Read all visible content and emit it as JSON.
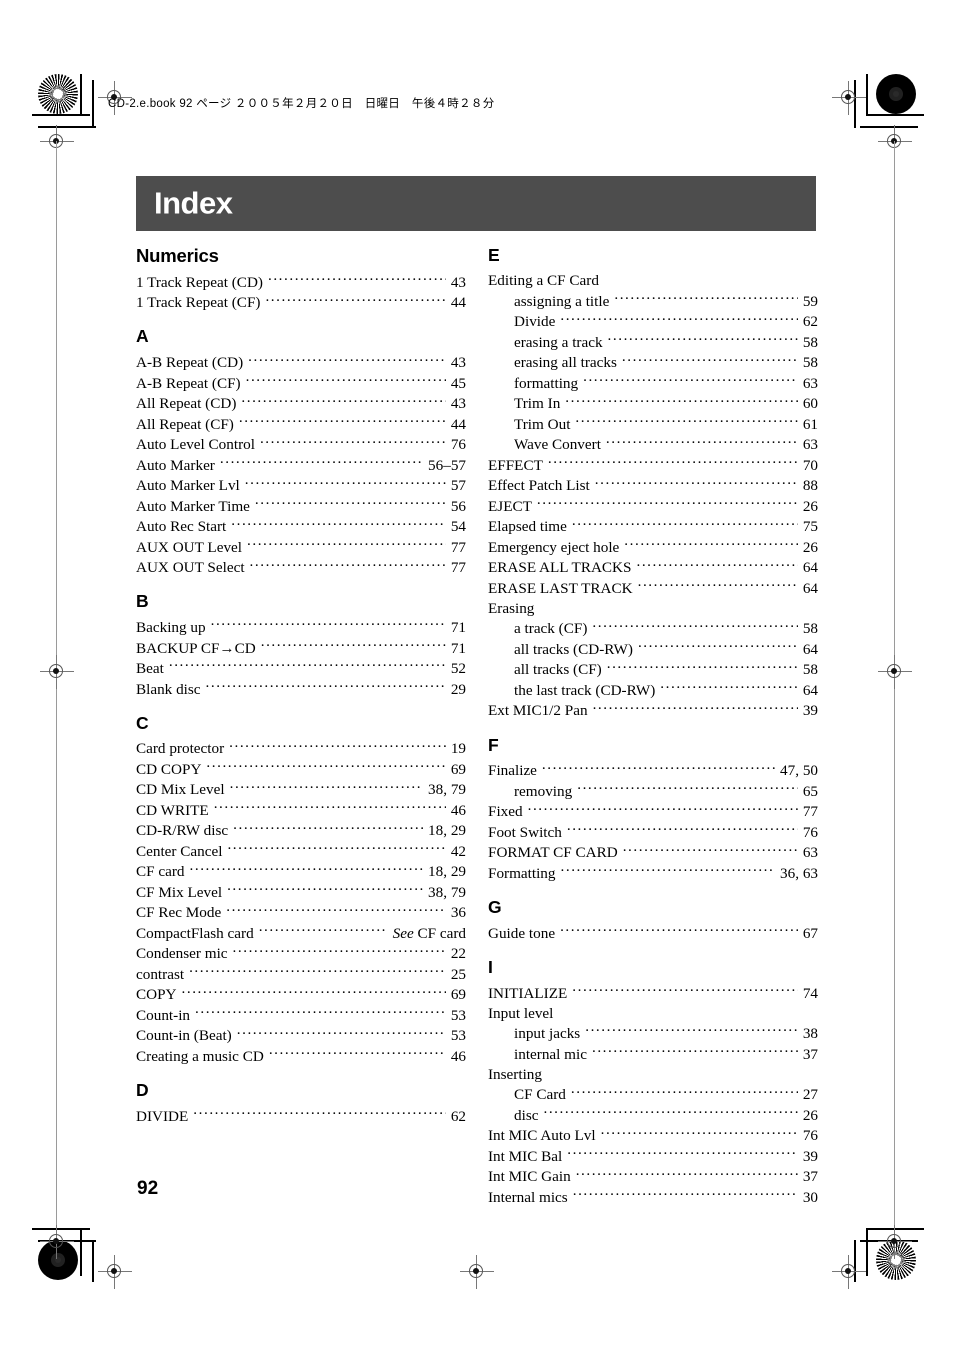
{
  "page_header": "CD-2.e.book  92 ページ  ２００５年２月２０日　日曜日　午後４時２８分",
  "title": "Index",
  "folio": "92",
  "colors": {
    "banner_background": "#4d4d4d",
    "banner_text": "#ffffff",
    "body_text": "#000000"
  },
  "columns": [
    {
      "name": "left-column",
      "sections": [
        {
          "heading": "Numerics",
          "entries": [
            {
              "label": "1 Track Repeat (CD)",
              "pages": "43",
              "level": 0
            },
            {
              "label": "1 Track Repeat (CF)",
              "pages": "44",
              "level": 0
            }
          ]
        },
        {
          "heading": "A",
          "entries": [
            {
              "label": "A-B Repeat (CD)",
              "pages": "43",
              "level": 0
            },
            {
              "label": "A-B Repeat (CF)",
              "pages": "45",
              "level": 0
            },
            {
              "label": "All Repeat (CD)",
              "pages": "43",
              "level": 0
            },
            {
              "label": "All Repeat (CF)",
              "pages": "44",
              "level": 0
            },
            {
              "label": "Auto Level Control",
              "pages": "76",
              "level": 0
            },
            {
              "label": "Auto Marker",
              "pages": "56–57",
              "level": 0
            },
            {
              "label": "Auto Marker Lvl",
              "pages": "57",
              "level": 0
            },
            {
              "label": "Auto Marker Time",
              "pages": "56",
              "level": 0
            },
            {
              "label": "Auto Rec Start",
              "pages": "54",
              "level": 0
            },
            {
              "label": "AUX OUT Level",
              "pages": "77",
              "level": 0
            },
            {
              "label": "AUX OUT Select",
              "pages": "77",
              "level": 0
            }
          ]
        },
        {
          "heading": "B",
          "entries": [
            {
              "label": "Backing up",
              "pages": "71",
              "level": 0
            },
            {
              "label": "BACKUP CF→CD",
              "pages": "71",
              "level": 0
            },
            {
              "label": "Beat",
              "pages": "52",
              "level": 0
            },
            {
              "label": "Blank disc",
              "pages": "29",
              "level": 0
            }
          ]
        },
        {
          "heading": "C",
          "entries": [
            {
              "label": "Card protector",
              "pages": "19",
              "level": 0
            },
            {
              "label": "CD COPY",
              "pages": "69",
              "level": 0
            },
            {
              "label": "CD Mix Level",
              "pages": "38, 79",
              "level": 0
            },
            {
              "label": "CD WRITE",
              "pages": "46",
              "level": 0
            },
            {
              "label": "CD-R/RW disc",
              "pages": "18, 29",
              "level": 0
            },
            {
              "label": "Center Cancel",
              "pages": "42",
              "level": 0
            },
            {
              "label": "CF card",
              "pages": "18, 29",
              "level": 0
            },
            {
              "label": "CF Mix Level",
              "pages": "38, 79",
              "level": 0
            },
            {
              "label": "CF Rec Mode",
              "pages": "36",
              "level": 0
            },
            {
              "label": "CompactFlash card",
              "pages": "See CF card",
              "level": 0,
              "crossref": true,
              "see_word": "See",
              "see_target": " CF card"
            },
            {
              "label": "Condenser mic",
              "pages": "22",
              "level": 0
            },
            {
              "label": "contrast",
              "pages": "25",
              "level": 0
            },
            {
              "label": "COPY",
              "pages": "69",
              "level": 0
            },
            {
              "label": "Count-in",
              "pages": "53",
              "level": 0
            },
            {
              "label": "Count-in (Beat)",
              "pages": "53",
              "level": 0
            },
            {
              "label": "Creating a music CD",
              "pages": "46",
              "level": 0
            }
          ]
        },
        {
          "heading": "D",
          "entries": [
            {
              "label": "DIVIDE",
              "pages": "62",
              "level": 0
            }
          ]
        }
      ]
    },
    {
      "name": "right-column",
      "sections": [
        {
          "heading": "E",
          "entries": [
            {
              "label": "Editing a CF Card",
              "pages": "",
              "level": 0,
              "noleader": true
            },
            {
              "label": "assigning a title",
              "pages": "59",
              "level": 1
            },
            {
              "label": "Divide",
              "pages": "62",
              "level": 1
            },
            {
              "label": "erasing a track",
              "pages": "58",
              "level": 1
            },
            {
              "label": "erasing all tracks",
              "pages": "58",
              "level": 1
            },
            {
              "label": "formatting",
              "pages": "63",
              "level": 1
            },
            {
              "label": "Trim In",
              "pages": "60",
              "level": 1
            },
            {
              "label": "Trim Out",
              "pages": "61",
              "level": 1
            },
            {
              "label": "Wave Convert",
              "pages": "63",
              "level": 1
            },
            {
              "label": "EFFECT",
              "pages": "70",
              "level": 0
            },
            {
              "label": "Effect Patch List",
              "pages": "88",
              "level": 0
            },
            {
              "label": "EJECT",
              "pages": "26",
              "level": 0
            },
            {
              "label": "Elapsed time",
              "pages": "75",
              "level": 0
            },
            {
              "label": "Emergency eject hole",
              "pages": "26",
              "level": 0
            },
            {
              "label": "ERASE ALL TRACKS",
              "pages": "64",
              "level": 0
            },
            {
              "label": "ERASE LAST TRACK",
              "pages": "64",
              "level": 0
            },
            {
              "label": "Erasing",
              "pages": "",
              "level": 0,
              "noleader": true
            },
            {
              "label": "a track (CF)",
              "pages": "58",
              "level": 1
            },
            {
              "label": "all tracks (CD-RW)",
              "pages": "64",
              "level": 1
            },
            {
              "label": "all tracks (CF)",
              "pages": "58",
              "level": 1
            },
            {
              "label": "the last track (CD-RW)",
              "pages": "64",
              "level": 1
            },
            {
              "label": "Ext MIC1/2 Pan",
              "pages": "39",
              "level": 0
            }
          ]
        },
        {
          "heading": "F",
          "entries": [
            {
              "label": "Finalize",
              "pages": "47, 50",
              "level": 0
            },
            {
              "label": "removing",
              "pages": "65",
              "level": 1
            },
            {
              "label": "Fixed",
              "pages": "77",
              "level": 0
            },
            {
              "label": "Foot Switch",
              "pages": "76",
              "level": 0
            },
            {
              "label": "FORMAT CF CARD",
              "pages": "63",
              "level": 0
            },
            {
              "label": "Formatting",
              "pages": "36, 63",
              "level": 0
            }
          ]
        },
        {
          "heading": "G",
          "entries": [
            {
              "label": "Guide tone",
              "pages": "67",
              "level": 0
            }
          ]
        },
        {
          "heading": "I",
          "entries": [
            {
              "label": "INITIALIZE",
              "pages": "74",
              "level": 0
            },
            {
              "label": "Input level",
              "pages": "",
              "level": 0,
              "noleader": true
            },
            {
              "label": "input jacks",
              "pages": "38",
              "level": 1
            },
            {
              "label": "internal mic",
              "pages": "37",
              "level": 1
            },
            {
              "label": "Inserting",
              "pages": "",
              "level": 0,
              "noleader": true
            },
            {
              "label": "CF Card",
              "pages": "27",
              "level": 1
            },
            {
              "label": "disc",
              "pages": "26",
              "level": 1
            },
            {
              "label": "Int MIC Auto Lvl",
              "pages": "76",
              "level": 0
            },
            {
              "label": "Int MIC Bal",
              "pages": "39",
              "level": 0
            },
            {
              "label": "Int MIC Gain",
              "pages": "37",
              "level": 0
            },
            {
              "label": "Internal mics",
              "pages": "30",
              "level": 0
            }
          ]
        }
      ]
    }
  ]
}
